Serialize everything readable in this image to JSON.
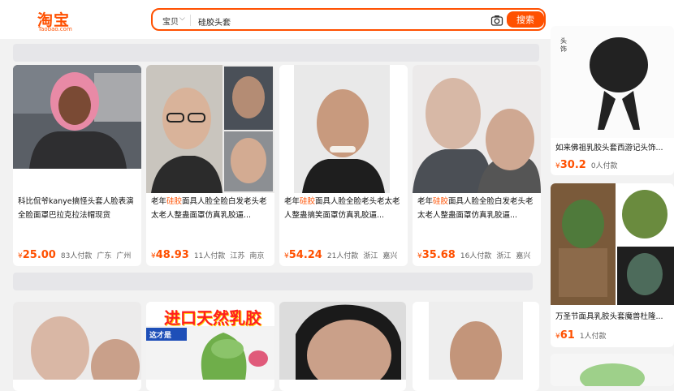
{
  "header": {
    "logo_cn": "淘宝",
    "logo_en": "Taobao.com",
    "scope": "宝贝",
    "search_query": "硅胶头套",
    "search_button": "搜索"
  },
  "products": [
    {
      "title_pre": "科比侃爷kanye搞怪头套人脸表演全脸面罩巴拉克拉法帽现货",
      "title_hl": "",
      "title_post": "",
      "currency": "¥",
      "price": "25.00",
      "sold": "83人付款",
      "loc1": "广东",
      "loc2": "广州"
    },
    {
      "title_pre": "老年",
      "title_hl": "硅胶",
      "title_post": "面具人脸全脸白发老头老太老人整蛊面罩仿真乳胶逼...",
      "currency": "¥",
      "price": "48.93",
      "sold": "11人付款",
      "loc1": "江苏",
      "loc2": "南京"
    },
    {
      "title_pre": "老年",
      "title_hl": "硅胶",
      "title_post": "面具人脸全脸老头老太老人整蛊搞笑面罩仿真乳胶逼...",
      "currency": "¥",
      "price": "54.24",
      "sold": "21人付款",
      "loc1": "浙江",
      "loc2": "嘉兴"
    },
    {
      "title_pre": "老年",
      "title_hl": "硅胶",
      "title_post": "面具人脸全脸白发老头老太老人整蛊面罩仿真乳胶逼...",
      "currency": "¥",
      "price": "35.68",
      "sold": "16人付款",
      "loc1": "浙江",
      "loc2": "嘉兴"
    }
  ],
  "side_products": [
    {
      "title": "如来佛祖乳胶头套西游记头饰...",
      "currency": "¥",
      "price": "30.2",
      "sold": "0人付款"
    },
    {
      "title": "万圣节面具乳胶头套魔兽杜隆...",
      "currency": "¥",
      "price": "61",
      "sold": "1人付款"
    }
  ],
  "bottom_banner_text": "进口天然乳胶",
  "bottom_banner_tag": "这才是",
  "side_box_label": "头饰",
  "colors": {
    "accent": "#ff5000",
    "background": "#f2f2f2"
  }
}
